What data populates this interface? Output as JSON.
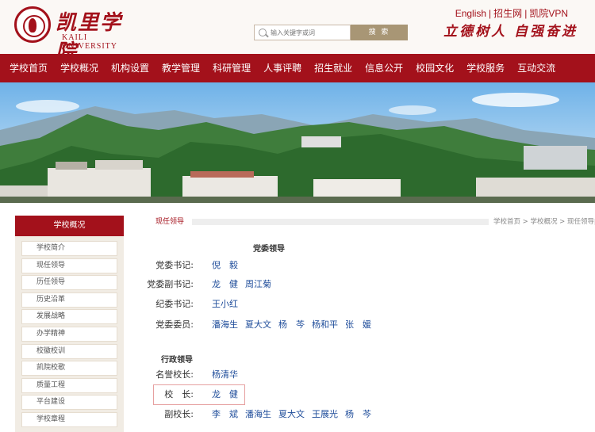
{
  "header": {
    "logo_cn": "凯里学院",
    "logo_en": "KAILI UNIVERSITY",
    "search_placeholder": "输入关键字或词",
    "search_button": "搜 索",
    "links": [
      "English",
      "招生网",
      "凯院VPN"
    ],
    "slogan": "立德树人 自强奋进"
  },
  "nav": [
    "学校首页",
    "学校概况",
    "机构设置",
    "教学管理",
    "科研管理",
    "人事评聘",
    "招生就业",
    "信息公开",
    "校园文化",
    "学校服务",
    "互动交流"
  ],
  "sidebar": {
    "title": "学校概况",
    "items": [
      "学校简介",
      "现任领导",
      "历任领导",
      "历史沿革",
      "发展战略",
      "办学精神",
      "校徽校训",
      "凯院校歌",
      "质量工程",
      "平台建设",
      "学校章程"
    ]
  },
  "breadcrumb": {
    "current": "现任领导",
    "path": "学校首页 > 学校概况 > 现任领导"
  },
  "party": {
    "title": "党委领导",
    "rows": [
      {
        "label": "党委书记:",
        "names": [
          "倪　毅"
        ]
      },
      {
        "label": "党委副书记:",
        "names": [
          "龙　健",
          "周江菊"
        ]
      },
      {
        "label": "纪委书记:",
        "names": [
          "王小红"
        ]
      },
      {
        "label": "党委委员:",
        "names": [
          "潘海生",
          "夏大文",
          "杨　芩",
          "杨和平",
          "张　媛"
        ]
      }
    ]
  },
  "admin": {
    "title": "行政领导",
    "rows": [
      {
        "label": "名誉校长:",
        "names": [
          "杨清华"
        ]
      },
      {
        "label": "校　长:",
        "names": [
          "龙　健"
        ]
      },
      {
        "label": "副校长:",
        "names": [
          "李　斌",
          "潘海生",
          "夏大文",
          "王展光",
          "杨　芩"
        ]
      }
    ]
  },
  "colors": {
    "brand": "#a3111b",
    "link": "#1e4c9a"
  }
}
